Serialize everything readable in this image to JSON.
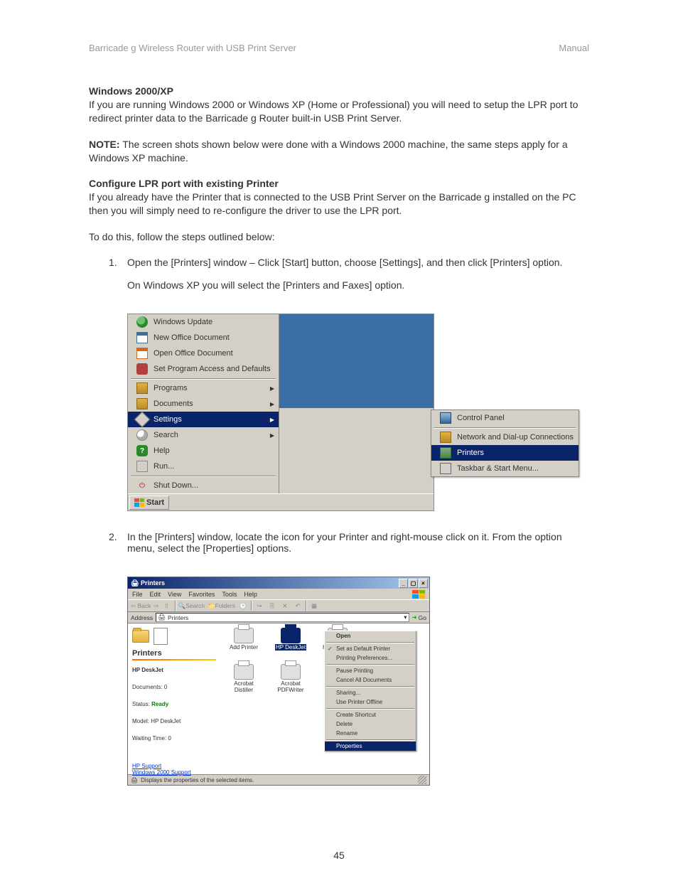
{
  "header": {
    "left": "Barricade g Wireless Router with USB Print Server",
    "right": "Manual"
  },
  "section1": {
    "heading": "Windows 2000/XP",
    "body": "If you are running Windows 2000 or Windows XP (Home or Professional) you will need to setup the LPR port to redirect printer data to the Barricade g Router built-in USB Print Server."
  },
  "note": {
    "label": "NOTE:",
    "body": "The screen shots shown below were done with a Windows 2000 machine, the same steps apply for a Windows XP machine."
  },
  "section2": {
    "heading": "Configure LPR port with existing Printer",
    "body": "If you already have the Printer that is connected to the USB Print Server on the Barricade g installed on the PC then you will simply need to re-configure the driver to use the LPR port.",
    "lead": "To do this, follow the steps outlined below:"
  },
  "steps": [
    {
      "num": "1.",
      "p1": "Open the [Printers] window – Click [Start] button, choose [Settings], and then click [Printers] option.",
      "p2": "On Windows XP you will select the [Printers and Faxes] option."
    },
    {
      "num": "2.",
      "p1": "In the [Printers] window, locate the icon for your Printer and right-mouse click on it. From the option menu, select the [Properties] options."
    }
  ],
  "start_menu": {
    "top_items": [
      "Windows Update",
      "New Office Document",
      "Open Office Document",
      "Set Program Access and Defaults"
    ],
    "main_items": [
      {
        "label": "Programs",
        "arrow": true
      },
      {
        "label": "Documents",
        "arrow": true
      },
      {
        "label": "Settings",
        "arrow": true,
        "highlight": true
      },
      {
        "label": "Search",
        "arrow": true
      },
      {
        "label": "Help",
        "arrow": false
      },
      {
        "label": "Run...",
        "arrow": false
      }
    ],
    "bottom_item": "Shut Down...",
    "submenu": [
      {
        "label": "Control Panel"
      },
      {
        "label": "Network and Dial-up Connections"
      },
      {
        "label": "Printers",
        "highlight": true
      },
      {
        "label": "Taskbar & Start Menu..."
      }
    ],
    "start_label": "Start"
  },
  "printers_window": {
    "title": "Printers",
    "menus": [
      "File",
      "Edit",
      "View",
      "Favorites",
      "Tools",
      "Help"
    ],
    "toolbar": {
      "back": "Back",
      "search": "Search",
      "folders": "Folders"
    },
    "address_label": "Address",
    "address_value": "Printers",
    "go": "Go",
    "left_panel": {
      "title": "Printers",
      "printer_name": "HP DeskJet",
      "documents": "Documents: 0",
      "status_label": "Status:",
      "status_value": "Ready",
      "model": "Model: HP DeskJet",
      "waiting": "Waiting Time: 0",
      "link1": "HP Support",
      "link2": "Windows 2000 Support"
    },
    "icons": [
      {
        "label": "Add Printer"
      },
      {
        "label": "HP DeskJet",
        "selected": true
      },
      {
        "label": "HP DeskJet"
      },
      {
        "label": "Acrobat Distiller"
      },
      {
        "label": "Acrobat PDFWriter"
      }
    ],
    "context_menu": [
      {
        "label": "Open",
        "bold": true
      },
      {
        "sep": true
      },
      {
        "label": "Set as Default Printer",
        "check": true
      },
      {
        "label": "Printing Preferences..."
      },
      {
        "sep": true
      },
      {
        "label": "Pause Printing"
      },
      {
        "label": "Cancel All Documents"
      },
      {
        "sep": true
      },
      {
        "label": "Sharing..."
      },
      {
        "label": "Use Printer Offline"
      },
      {
        "sep": true
      },
      {
        "label": "Create Shortcut"
      },
      {
        "label": "Delete"
      },
      {
        "label": "Rename"
      },
      {
        "sep": true
      },
      {
        "label": "Properties",
        "highlight": true
      }
    ],
    "statusbar": "Displays the properties of the selected items."
  },
  "page_number": "45"
}
